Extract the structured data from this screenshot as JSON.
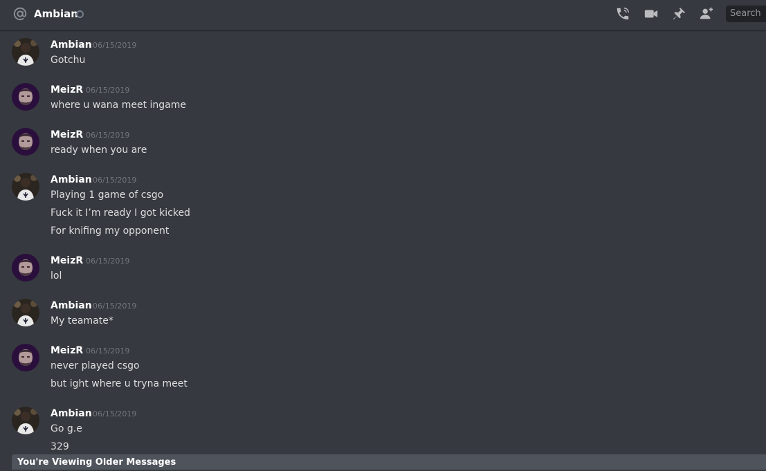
{
  "header": {
    "title": "Ambian",
    "search_placeholder": "Search",
    "icons": [
      "at-icon",
      "call-icon",
      "video-icon",
      "pin-icon",
      "add-friend-icon"
    ]
  },
  "messages": [
    {
      "author": "Ambian",
      "timestamp": "06/15/2019",
      "avatar": "ambian-avatar",
      "lines": [
        "Gotchu"
      ]
    },
    {
      "author": "MeizR",
      "timestamp": "06/15/2019",
      "avatar": "meizr-avatar",
      "lines": [
        "where u wana meet ingame"
      ]
    },
    {
      "author": "MeizR",
      "timestamp": "06/15/2019",
      "avatar": "meizr-avatar",
      "lines": [
        "ready when you are"
      ]
    },
    {
      "author": "Ambian",
      "timestamp": "06/15/2019",
      "avatar": "ambian-avatar",
      "lines": [
        "Playing 1 game of csgo",
        "Fuck it I’m ready I got kicked",
        "For knifing my opponent"
      ]
    },
    {
      "author": "MeizR",
      "timestamp": "06/15/2019",
      "avatar": "meizr-avatar",
      "lines": [
        "lol"
      ]
    },
    {
      "author": "Ambian",
      "timestamp": "06/15/2019",
      "avatar": "ambian-avatar",
      "lines": [
        "My teamate*"
      ]
    },
    {
      "author": "MeizR",
      "timestamp": "06/15/2019",
      "avatar": "meizr-avatar",
      "lines": [
        "never played csgo",
        "but ight where u tryna meet"
      ]
    },
    {
      "author": "Ambian",
      "timestamp": "06/15/2019",
      "avatar": "ambian-avatar",
      "lines": [
        "Go g.e",
        "329"
      ]
    }
  ],
  "older_messages_bar": "You're Viewing Older Messages",
  "colors": {
    "background": "#36393f",
    "username": "#ffffff",
    "message_text": "#dcddde",
    "timestamp": "#72767d",
    "older_bar": "#4f545c"
  }
}
